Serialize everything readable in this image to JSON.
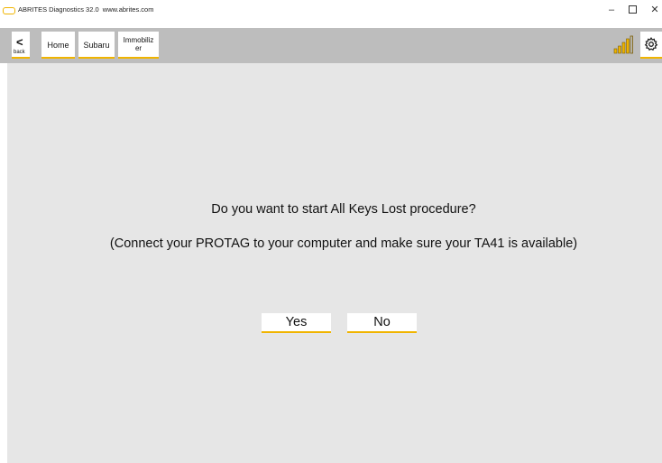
{
  "window": {
    "title": "ABRITES Diagnostics 32.0",
    "url": "www.abrites.com",
    "controls": {
      "minimize": "–",
      "close": "✕"
    }
  },
  "toolbar": {
    "back_label": "back",
    "back_glyph": "<",
    "breadcrumbs": {
      "home": "Home",
      "subaru": "Subaru",
      "immobilizer_line1": "Immobiliz",
      "immobilizer_line2": "er"
    },
    "icons": [
      "signal-bars-icon",
      "gear-icon"
    ]
  },
  "dialog": {
    "question": "Do you want to start All Keys Lost procedure?",
    "instruction": "(Connect your PROTAG to your computer and make sure your TA41 is available)",
    "yes_label": "Yes",
    "no_label": "No"
  },
  "colors": {
    "accent": "#f0b400",
    "toolbar_bg": "#bdbdbd",
    "content_bg": "#e6e6e6"
  }
}
